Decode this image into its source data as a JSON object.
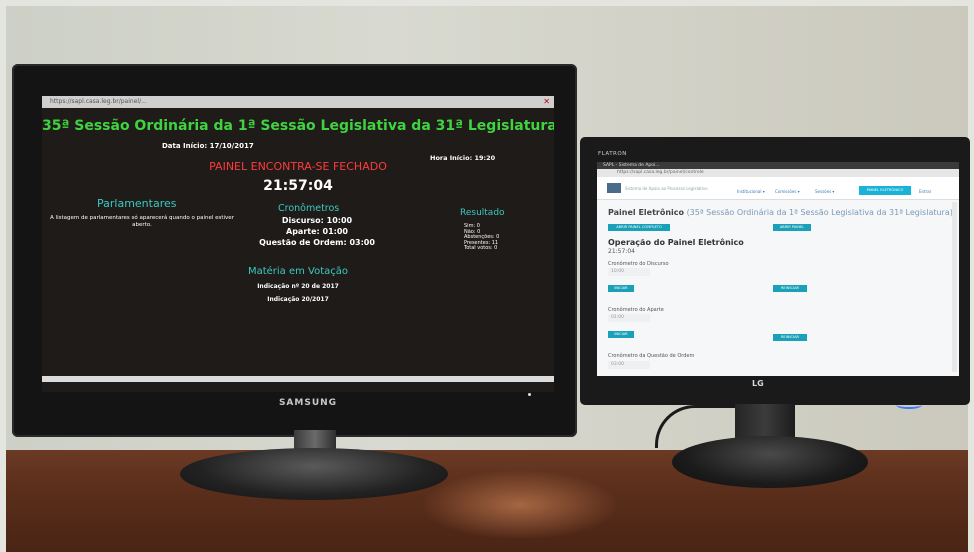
{
  "samsung": {
    "browser_url": "https://sapl.casa.leg.br/painel/...",
    "title": "35ª Sessão Ordinária da 1ª Sessão Legislativa da 31ª Legislatura",
    "data_inicio": "Data Início: 17/10/2017",
    "hora_inicio": "Hora Início: 19:20",
    "status": "PAINEL ENCONTRA-SE FECHADO",
    "clock": "21:57:04",
    "parlamentares_heading": "Parlamentares",
    "parlamentares_note": "A listagem de parlamentares só aparecerá quando o painel estiver aberto.",
    "cronometros_heading": "Cronômetros",
    "discurso": "Discurso: 10:00",
    "aparte": "Aparte: 01:00",
    "questao_ordem": "Questão de Ordem: 03:00",
    "resultado_heading": "Resultado",
    "resultado": [
      "Sim: 0",
      "Não: 0",
      "Abstenções: 0",
      "Presentes: 11",
      "Total votos: 0"
    ],
    "materia_heading": "Matéria em Votação",
    "materia_1": "Indicação nº 20 de 2017",
    "materia_2": "Indicação 20/2017",
    "brand": "SAMSUNG"
  },
  "lg": {
    "flatron": "FLATRON",
    "brand": "LG",
    "tab_label": "SAPL - Sistema de Apoi...",
    "address": "https://sapl.casa.leg.br/painel/controle",
    "site_name": "Sistema de Apoio ao Processo Legislativo",
    "menu": [
      "Institucional ▾",
      "Comissões ▾",
      "Sessões ▾"
    ],
    "nav_button": "PAINEL ELETRÔNICO",
    "nav_right": "Entrar",
    "panel_title": "Painel Eletrônico",
    "panel_subtitle": "(35ª Sessão Ordinária da 1ª Sessão Legislativa da 31ª Legislatura)",
    "btn_painel_completo": "ABRIR PAINEL COMPLETO",
    "btn_abrir_painel": "ABRIR PAINEL",
    "operacao_heading": "Operação do Painel Eletrônico",
    "operacao_time": "21:57:04",
    "cron_discurso_label": "Cronômetro do Discurso",
    "cron_discurso_value": "10:00",
    "cron_aparte_label": "Cronômetro do Aparte",
    "cron_aparte_value": "01:00",
    "cron_ordem_label": "Cronômetro da Questão de Ordem",
    "cron_ordem_value": "03:00",
    "btn_iniciar": "INICIAR",
    "btn_reiniciar": "REINICIAR"
  }
}
